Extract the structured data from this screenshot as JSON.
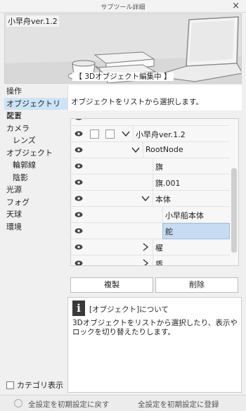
{
  "window": {
    "title": "サブツール詳細",
    "close_glyph": "×"
  },
  "preview": {
    "tool_name": "小早舟ver.1.2",
    "caption": "【 3Dオブジェクト編集中 】"
  },
  "categories": [
    {
      "label": "操作",
      "indent": false,
      "selected": false
    },
    {
      "label": "オブジェクトリスト",
      "indent": false,
      "selected": true
    },
    {
      "label": "配置",
      "indent": false,
      "selected": false
    },
    {
      "label": "カメラ",
      "indent": false,
      "selected": false
    },
    {
      "label": "レンズ",
      "indent": true,
      "selected": false
    },
    {
      "label": "オブジェクト",
      "indent": false,
      "selected": false
    },
    {
      "label": "輪郭線",
      "indent": true,
      "selected": false
    },
    {
      "label": "陰影",
      "indent": true,
      "selected": false
    },
    {
      "label": "光源",
      "indent": false,
      "selected": false
    },
    {
      "label": "フォグ",
      "indent": false,
      "selected": false
    },
    {
      "label": "天球",
      "indent": false,
      "selected": false
    },
    {
      "label": "環境",
      "indent": false,
      "selected": false
    }
  ],
  "category_footer": {
    "label": "カテゴリ表示",
    "checked": false
  },
  "main": {
    "description": "オブジェクトをリストから選択します。"
  },
  "tree": [
    {
      "label": "小早舟ver.1.2",
      "level": 0,
      "arrow": "down",
      "checkboxes": true,
      "selected": false
    },
    {
      "label": "RootNode",
      "level": 1,
      "arrow": "down",
      "checkboxes": false,
      "selected": false
    },
    {
      "label": "旗",
      "level": 2,
      "arrow": "none",
      "checkboxes": false,
      "selected": false
    },
    {
      "label": "旗.001",
      "level": 2,
      "arrow": "none",
      "checkboxes": false,
      "selected": false
    },
    {
      "label": "本体",
      "level": 2,
      "arrow": "down",
      "checkboxes": false,
      "selected": false
    },
    {
      "label": "小早船本体",
      "level": 3,
      "arrow": "none",
      "checkboxes": false,
      "selected": false
    },
    {
      "label": "舵",
      "level": 3,
      "arrow": "none",
      "checkboxes": false,
      "selected": true
    },
    {
      "label": "櫂",
      "level": 2,
      "arrow": "right",
      "checkboxes": false,
      "selected": false
    },
    {
      "label": "盾",
      "level": 2,
      "arrow": "right",
      "checkboxes": false,
      "selected": false
    }
  ],
  "buttons": {
    "duplicate": "複製",
    "delete": "削除"
  },
  "info": {
    "title": "[オブジェクト]について",
    "body": "3Dオブジェクトをリストから選択したり、表示やロックを切り替えたりします。"
  },
  "footer": {
    "reset_label": "全設定を初期設定に戻す",
    "register_label": "全設定を初期設定に登録"
  },
  "colors": {
    "selection": "#c6dcf2",
    "category_selected": "#cde3f7"
  }
}
